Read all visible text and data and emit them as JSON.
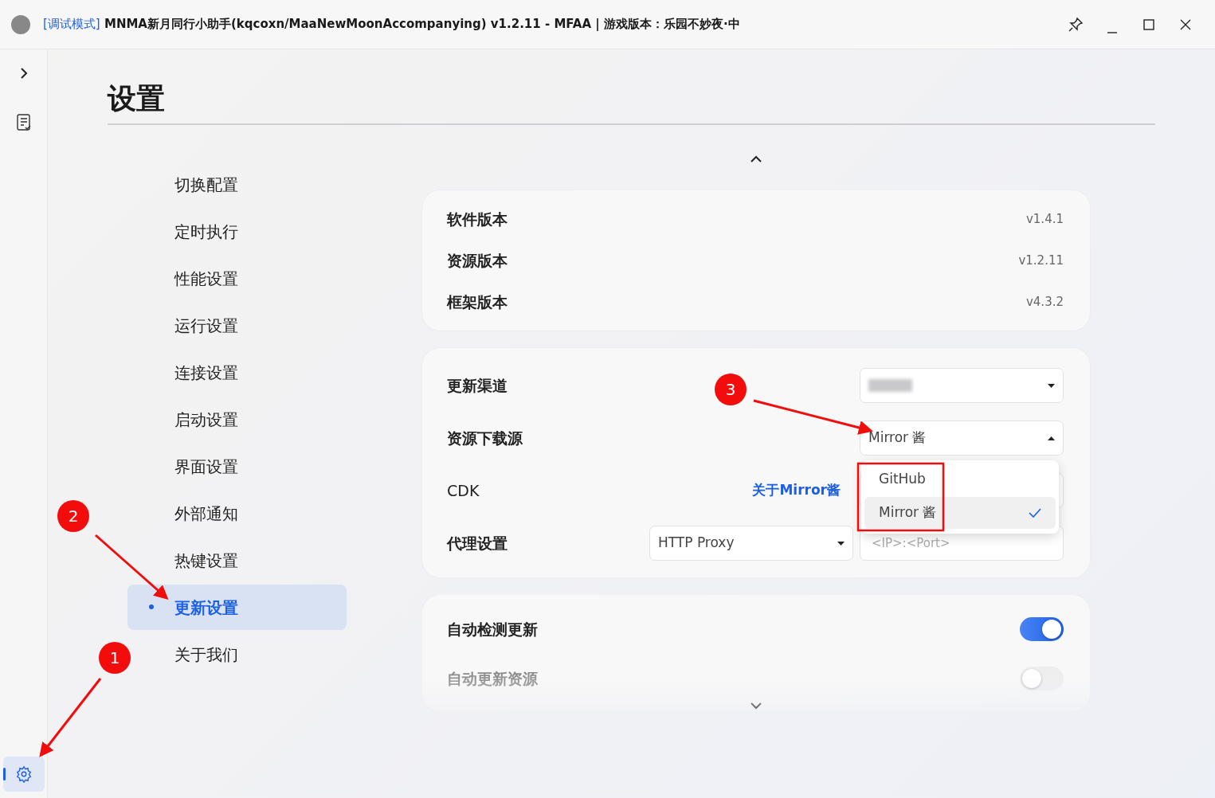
{
  "window": {
    "mode_tag": "[调试模式]",
    "title": "MNMA新月同行小助手(kqcoxn/MaaNewMoonAccompanying) v1.2.11 - MFAA | 游戏版本：乐园不妙夜·中"
  },
  "sidebar": {
    "items": [
      {
        "kind": "expand",
        "selected": false
      },
      {
        "kind": "log",
        "selected": false
      },
      {
        "kind": "settings",
        "selected": true
      }
    ]
  },
  "page": {
    "title": "设置"
  },
  "nav": [
    {
      "label": "切换配置",
      "selected": false
    },
    {
      "label": "定时执行",
      "selected": false
    },
    {
      "label": "性能设置",
      "selected": false
    },
    {
      "label": "运行设置",
      "selected": false
    },
    {
      "label": "连接设置",
      "selected": false
    },
    {
      "label": "启动设置",
      "selected": false
    },
    {
      "label": "界面设置",
      "selected": false
    },
    {
      "label": "外部通知",
      "selected": false
    },
    {
      "label": "热键设置",
      "selected": false
    },
    {
      "label": "更新设置",
      "selected": true
    },
    {
      "label": "关于我们",
      "selected": false
    }
  ],
  "versions": [
    {
      "label": "软件版本",
      "value": "v1.4.1"
    },
    {
      "label": "资源版本",
      "value": "v1.2.11"
    },
    {
      "label": "框架版本",
      "value": "v4.3.2"
    }
  ],
  "update_rows": [
    {
      "kind": "select",
      "label": "更新渠道",
      "blurred": true
    },
    {
      "kind": "select",
      "label": "资源下载源",
      "value": "Mirror 酱",
      "expanded": true,
      "options": [
        {
          "label": "GitHub",
          "selected": false
        },
        {
          "label": "Mirror 酱",
          "selected": true
        }
      ]
    },
    {
      "kind": "input",
      "label": "CDK",
      "link": "关于Mirror酱"
    },
    {
      "kind": "proxy",
      "label": "代理设置",
      "value": "HTTP Proxy",
      "placeholder": "<IP>:<Port>"
    }
  ],
  "toggles": [
    {
      "label": "自动检测更新",
      "on": true,
      "disabled": false
    },
    {
      "label": "自动更新资源",
      "on": false,
      "disabled": true
    }
  ],
  "annotations": [
    {
      "label": "1"
    },
    {
      "label": "2"
    },
    {
      "label": "3"
    }
  ]
}
